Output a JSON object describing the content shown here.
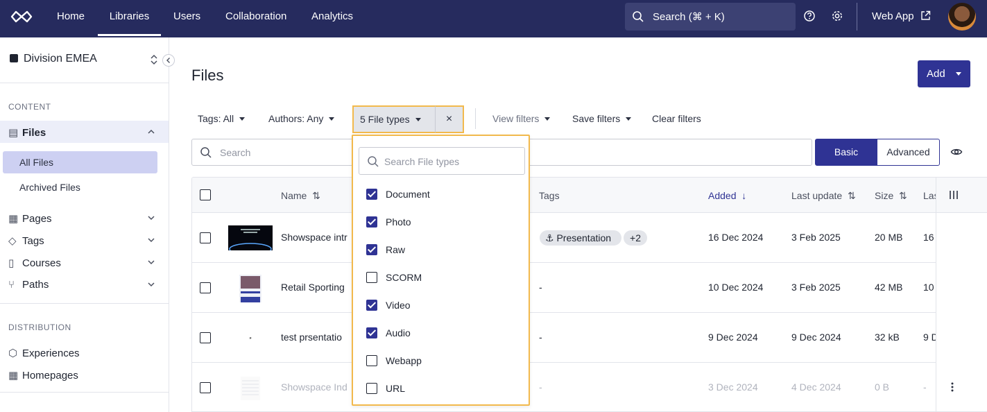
{
  "nav": {
    "items": [
      "Home",
      "Libraries",
      "Users",
      "Collaboration",
      "Analytics"
    ],
    "active": "Libraries",
    "search_placeholder": "Search (⌘ + K)",
    "web_app": "Web App"
  },
  "sidebar": {
    "division": "Division EMEA",
    "content_heading": "CONTENT",
    "files": "Files",
    "all_files": "All Files",
    "archived_files": "Archived Files",
    "pages": "Pages",
    "tags": "Tags",
    "courses": "Courses",
    "paths": "Paths",
    "distribution_heading": "DISTRIBUTION",
    "experiences": "Experiences",
    "homepages": "Homepages"
  },
  "main": {
    "title": "Files",
    "add_label": "Add",
    "filters": {
      "tags": "Tags: All",
      "authors": "Authors: Any",
      "file_types": "5 File types",
      "clear_x": "×",
      "view_filters": "View filters",
      "save_filters": "Save filters",
      "clear_filters": "Clear filters"
    },
    "search_placeholder": "Search",
    "mode_basic": "Basic",
    "mode_advanced": "Advanced"
  },
  "table": {
    "headers": {
      "name": "Name",
      "tags": "Tags",
      "added": "Added",
      "last_update": "Last update",
      "size": "Size",
      "last_col": "Las"
    },
    "rows": [
      {
        "name": "Showspace intr",
        "tag": "Presentation",
        "tag_more": "+2",
        "added": "16 Dec 2024",
        "updated": "3 Feb 2025",
        "size": "20 MB",
        "last": "16"
      },
      {
        "name": "Retail Sporting",
        "tag": "-",
        "tag_more": "",
        "added": "10 Dec 2024",
        "updated": "3 Feb 2025",
        "size": "42 MB",
        "last": "10"
      },
      {
        "name": "test prsentatio",
        "tag": "-",
        "tag_more": "",
        "added": "9 Dec 2024",
        "updated": "9 Dec 2024",
        "size": "32 kB",
        "last": "9 D"
      },
      {
        "name": "Showspace Ind",
        "tag": "-",
        "tag_more": "",
        "added": "3 Dec 2024",
        "updated": "4 Dec 2024",
        "size": "0 B",
        "last": "-"
      }
    ]
  },
  "file_type_dropdown": {
    "search_placeholder": "Search File types",
    "options": [
      {
        "label": "Document",
        "checked": true
      },
      {
        "label": "Photo",
        "checked": true
      },
      {
        "label": "Raw",
        "checked": true
      },
      {
        "label": "SCORM",
        "checked": false
      },
      {
        "label": "Video",
        "checked": true
      },
      {
        "label": "Audio",
        "checked": true
      },
      {
        "label": "Webapp",
        "checked": false
      },
      {
        "label": "URL",
        "checked": false
      }
    ]
  },
  "colors": {
    "nav_bg": "#262b5e",
    "accent": "#2f3394",
    "highlight": "#f2b94c"
  }
}
